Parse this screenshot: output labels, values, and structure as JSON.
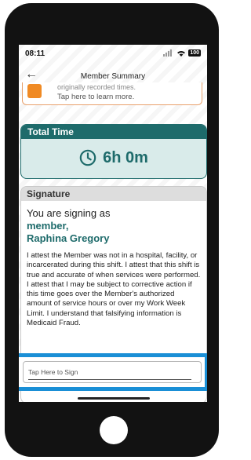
{
  "status": {
    "time": "08:11",
    "battery": "100"
  },
  "header": {
    "title": "Member Summary"
  },
  "notice": {
    "line1": "originally recorded times.",
    "line2": "Tap here to learn more."
  },
  "total_time": {
    "heading": "Total Time",
    "value": "6h 0m"
  },
  "signature": {
    "heading": "Signature",
    "signing_as": "You are signing as",
    "role": "member,",
    "name": "Raphina Gregory",
    "attestation": "I attest the Member was not in a hospital, facility, or incarcerated during this shift. I attest that this shift is true and accurate of when services were performed. I attest that I may be subject to corrective action if this time goes over the Member's authorized amount of service hours or over my Work Week Limit. I understand that falsifying information is Medicaid Fraud.",
    "tap_to_sign": "Tap Here to Sign"
  },
  "colors": {
    "accent": "#1e6b6b",
    "highlight": "#1a8fd6",
    "notice": "#f08a24"
  }
}
